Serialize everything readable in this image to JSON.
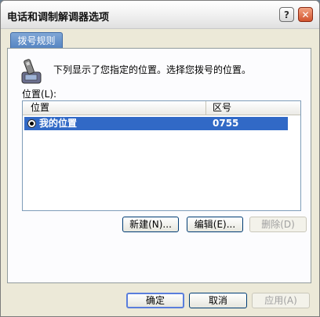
{
  "window": {
    "title": "电话和调制解调器选项"
  },
  "titlebar": {
    "help_glyph": "?",
    "close_glyph": "✕"
  },
  "tabs": [
    {
      "label": "拨号规则"
    }
  ],
  "panel": {
    "description": "下列显示了您指定的位置。选择您拨号的位置。",
    "locations_label": "位置(L):"
  },
  "listview": {
    "columns": [
      "位置",
      "区号"
    ],
    "rows": [
      {
        "name": "我的位置",
        "area_code": "0755",
        "selected": true
      }
    ]
  },
  "buttons": {
    "new": "新建(N)...",
    "edit": "编辑(E)...",
    "delete": "删除(D)",
    "ok": "确定",
    "cancel": "取消",
    "apply": "应用(A)"
  },
  "colors": {
    "selection": "#3169c6",
    "tab": "#5484c1",
    "close": "#d2532e"
  }
}
